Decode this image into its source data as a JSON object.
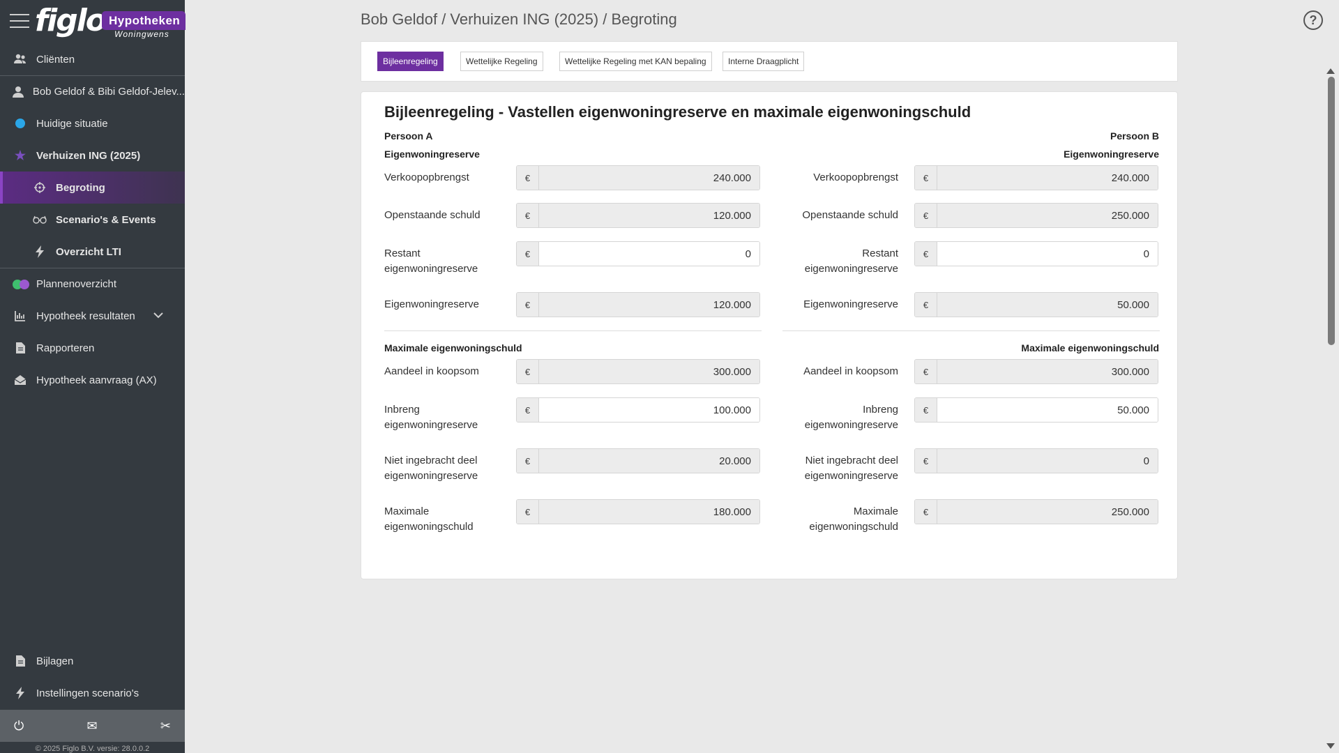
{
  "brand": {
    "logo": "figlo",
    "badge": "Hypotheken",
    "sub": "Woningwens"
  },
  "sidebar": {
    "items": [
      {
        "label": "Cliënten",
        "icon": "users-icon"
      },
      {
        "label": "Bob Geldof & Bibi Geldof-Jelev...",
        "icon": "user-icon"
      },
      {
        "label": "Huidige situatie",
        "icon": "blue-dot-icon"
      },
      {
        "label": "Verhuizen ING (2025)",
        "icon": "star-icon"
      },
      {
        "label": "Begroting",
        "icon": "crosshair-icon"
      },
      {
        "label": "Scenario's & Events",
        "icon": "glasses-icon"
      },
      {
        "label": "Overzicht LTI",
        "icon": "bolt-icon"
      },
      {
        "label": "Plannenoverzicht",
        "icon": "toggle-icon"
      },
      {
        "label": "Hypotheek resultaten",
        "icon": "chart-icon"
      },
      {
        "label": "Rapporteren",
        "icon": "document-icon"
      },
      {
        "label": "Hypotheek aanvraag (AX)",
        "icon": "envelope-open-icon"
      }
    ],
    "bottom": [
      {
        "label": "Bijlagen",
        "icon": "document-icon"
      },
      {
        "label": "Instellingen scenario's",
        "icon": "bolt-icon"
      }
    ],
    "footer_icons": {
      "power": "⏻",
      "mail": "✉",
      "tools": "✂"
    },
    "copyright": "© 2025 Figlo B.V. versie: 28.0.0.2"
  },
  "header": {
    "breadcrumb": "Bob Geldof / Verhuizen ING (2025) / Begroting",
    "help": "?"
  },
  "tabs": [
    "Bijleenregeling",
    "Wettelijke Regeling",
    "Wettelijke Regeling met KAN bepaling",
    "Interne Draagplicht"
  ],
  "card": {
    "title": "Bijleenregeling - Vastellen eigenwoningreserve en maximale eigenwoningschuld",
    "currency": "€",
    "personA": {
      "name": "Persoon A",
      "section1": "Eigenwoningreserve",
      "verkoopopbrengst": {
        "label": "Verkoopopbrengst",
        "value": "240.000"
      },
      "openstaande_schuld": {
        "label": "Openstaande schuld",
        "value": "120.000"
      },
      "restant": {
        "label1": "Restant",
        "label2": "eigenwoningreserve",
        "value": "0"
      },
      "eigenwoningreserve": {
        "label": "Eigenwoningreserve",
        "value": "120.000"
      },
      "section2": "Maximale eigenwoningschuld",
      "aandeel": {
        "label": "Aandeel in koopsom",
        "value": "300.000"
      },
      "inbreng": {
        "label1": "Inbreng",
        "label2": "eigenwoningreserve",
        "value": "100.000"
      },
      "niet_ingebracht": {
        "label1": "Niet ingebracht deel",
        "label2": "eigenwoningreserve",
        "value": "20.000"
      },
      "maximale": {
        "label1": "Maximale",
        "label2": "eigenwoningschuld",
        "value": "180.000"
      }
    },
    "personB": {
      "name": "Persoon B",
      "section1": "Eigenwoningreserve",
      "verkoopopbrengst": {
        "label": "Verkoopopbrengst",
        "value": "240.000"
      },
      "openstaande_schuld": {
        "label": "Openstaande schuld",
        "value": "250.000"
      },
      "restant": {
        "label1": "Restant",
        "label2": "eigenwoningreserve",
        "value": "0"
      },
      "eigenwoningreserve": {
        "label": "Eigenwoningreserve",
        "value": "50.000"
      },
      "section2": "Maximale eigenwoningschuld",
      "aandeel": {
        "label": "Aandeel in koopsom",
        "value": "300.000"
      },
      "inbreng": {
        "label1": "Inbreng",
        "label2": "eigenwoningreserve",
        "value": "50.000"
      },
      "niet_ingebracht": {
        "label1": "Niet ingebracht deel",
        "label2": "eigenwoningreserve",
        "value": "0"
      },
      "maximale": {
        "label1": "Maximale",
        "label2": "eigenwoningschuld",
        "value": "250.000"
      }
    }
  }
}
